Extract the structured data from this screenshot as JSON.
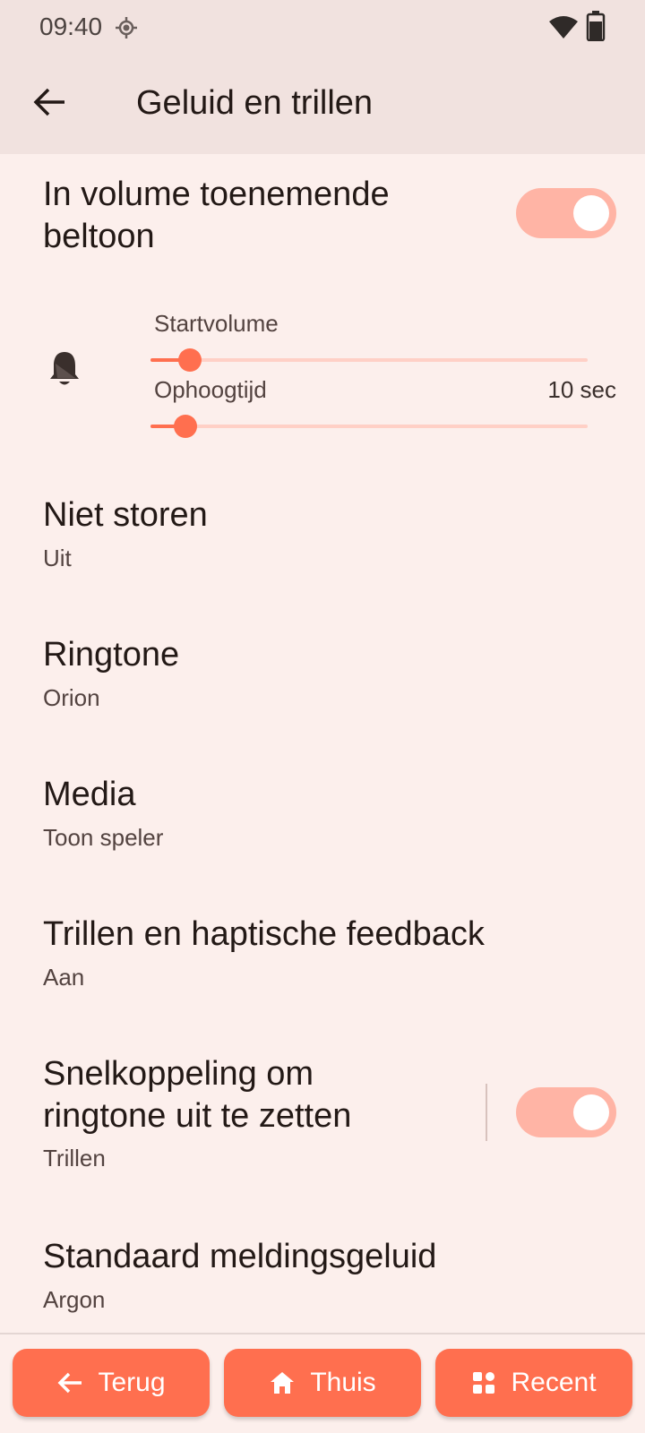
{
  "status": {
    "time": "09:40",
    "icons": [
      "location-icon",
      "wifi-icon",
      "battery-icon"
    ]
  },
  "app_bar": {
    "title": "Geluid en trillen",
    "back_icon": "arrow-left-icon"
  },
  "increasing_ring": {
    "title_line1": "In volume toenemende",
    "title_line2": "beltoon",
    "enabled": true
  },
  "sliders": {
    "start_volume": {
      "label": "Startvolume",
      "value": 0.09
    },
    "ramp_time": {
      "label": "Ophoogtijd",
      "value_text": "10 sec",
      "value": 0.08
    }
  },
  "items": [
    {
      "title": "Niet storen",
      "summary": "Uit"
    },
    {
      "title": "Ringtone",
      "summary": "Orion"
    },
    {
      "title": "Media",
      "summary": "Toon speler"
    },
    {
      "title": "Trillen en haptische feedback",
      "summary": "Aan"
    }
  ],
  "shortcut": {
    "title_line1": "Snelkoppeling om",
    "title_line2": "ringtone uit te zetten",
    "summary": "Trillen",
    "enabled": true
  },
  "notification_sound": {
    "title": "Standaard meldingsgeluid",
    "summary": "Argon"
  },
  "nav": {
    "back": "Terug",
    "home": "Thuis",
    "recent": "Recent"
  },
  "colors": {
    "accent": "#ff6f4f",
    "switch_track": "#ffb4a5",
    "background": "#fcefec",
    "top_bar": "#f1e2df"
  }
}
